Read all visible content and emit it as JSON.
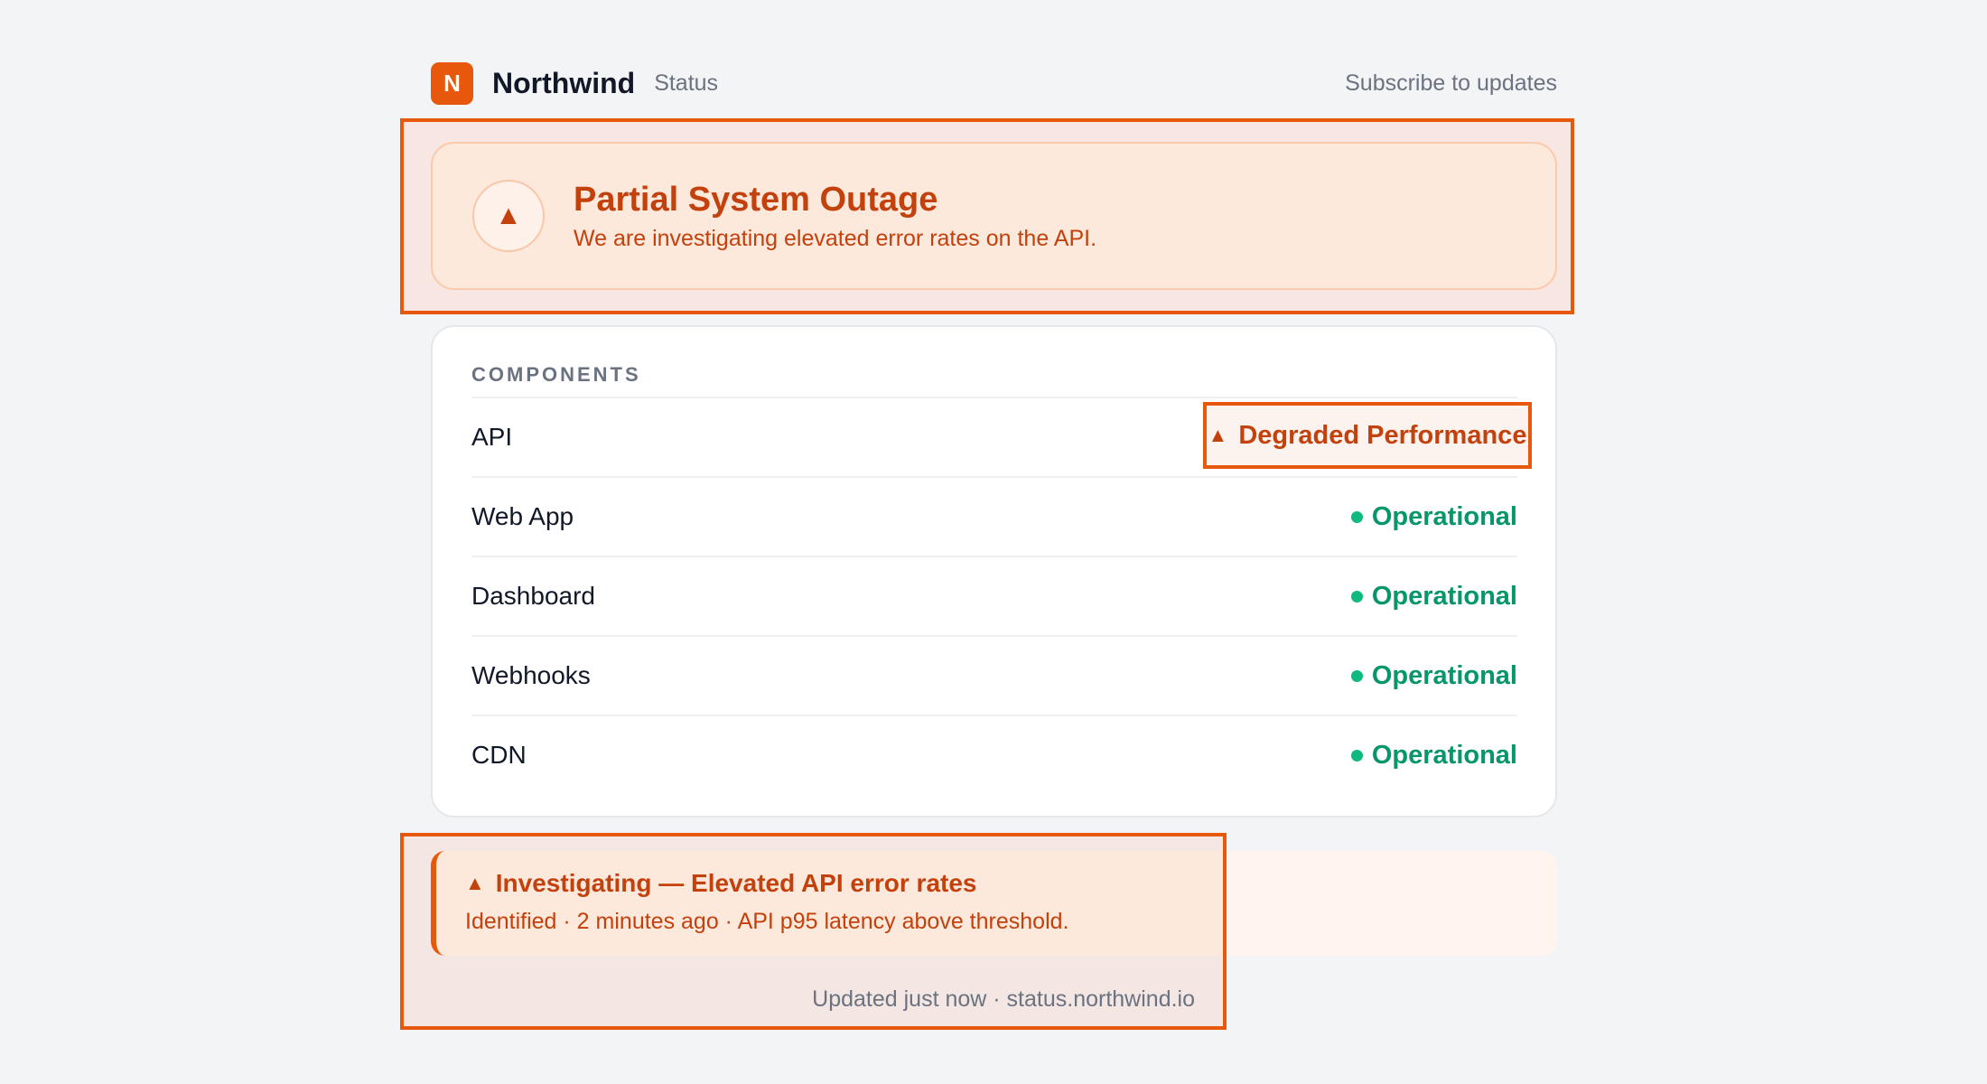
{
  "header": {
    "logo_letter": "N",
    "brand": "Northwind",
    "sub": "Status",
    "subscribe": "Subscribe to updates"
  },
  "hero": {
    "icon": "warning-triangle-icon",
    "title": "Partial System Outage",
    "description": "We are investigating elevated error rates on the API."
  },
  "components": {
    "heading": "COMPONENTS",
    "items": [
      {
        "name": "API",
        "status": "Degraded Performance",
        "state": "degraded"
      },
      {
        "name": "Web App",
        "status": "Operational",
        "state": "ok"
      },
      {
        "name": "Dashboard",
        "status": "Operational",
        "state": "ok"
      },
      {
        "name": "Webhooks",
        "status": "Operational",
        "state": "ok"
      },
      {
        "name": "CDN",
        "status": "Operational",
        "state": "ok"
      }
    ]
  },
  "incident": {
    "title": "Investigating — Elevated API error rates",
    "meta": "Identified · 2 minutes ago · API p95 latency above threshold."
  },
  "footer": {
    "note": "Updated just now · status.northwind.io"
  },
  "colors": {
    "accent": "#e8580c",
    "warning_text": "#c2410c",
    "operational": "#059669",
    "background": "#f3f4f6"
  }
}
